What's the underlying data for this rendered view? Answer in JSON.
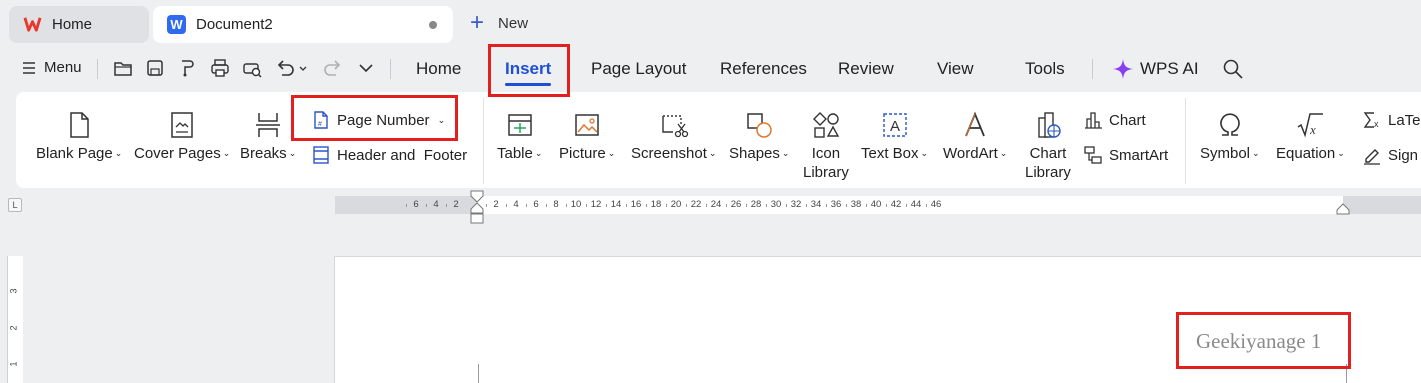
{
  "tabs": {
    "home": {
      "label": "Home"
    },
    "document": {
      "label": "Document2"
    },
    "new": {
      "label": "New"
    }
  },
  "menubar": {
    "menu_label": "Menu",
    "tabs": [
      "Home",
      "Insert",
      "Page Layout",
      "References",
      "Review",
      "View",
      "Tools"
    ],
    "active_tab": "Insert",
    "wps_ai": "WPS AI"
  },
  "ribbon": {
    "blank_page": "Blank Page",
    "cover_pages": "Cover Pages",
    "breaks": "Breaks",
    "page_number": "Page Number",
    "header_footer": "Header and  Footer",
    "table": "Table",
    "picture": "Picture",
    "screenshot": "Screenshot",
    "shapes": "Shapes",
    "icon_library": [
      "Icon",
      "Library"
    ],
    "text_box": "Text Box",
    "wordart": "WordArt",
    "chart_library": [
      "Chart",
      "Library"
    ],
    "chart": "Chart",
    "smartart": "SmartArt",
    "symbol": "Symbol",
    "equation": "Equation",
    "latex": "LaTeX",
    "sign": "Sign"
  },
  "ruler": {
    "left_numbers": [
      "6",
      "4",
      "2"
    ],
    "right_numbers": [
      "2",
      "4",
      "6",
      "8",
      "10",
      "12",
      "14",
      "16",
      "18",
      "20",
      "22",
      "24",
      "26",
      "28",
      "30",
      "32",
      "34",
      "36",
      "38",
      "40",
      "42",
      "44",
      "46"
    ],
    "vertical_numbers": [
      "3",
      "2",
      "1"
    ],
    "corner": "L"
  },
  "document": {
    "header_text": "Geekiyanage 1"
  },
  "colors": {
    "accent": "#1e4fd6",
    "highlight": "#e32020",
    "wps_red": "#e8372e"
  }
}
